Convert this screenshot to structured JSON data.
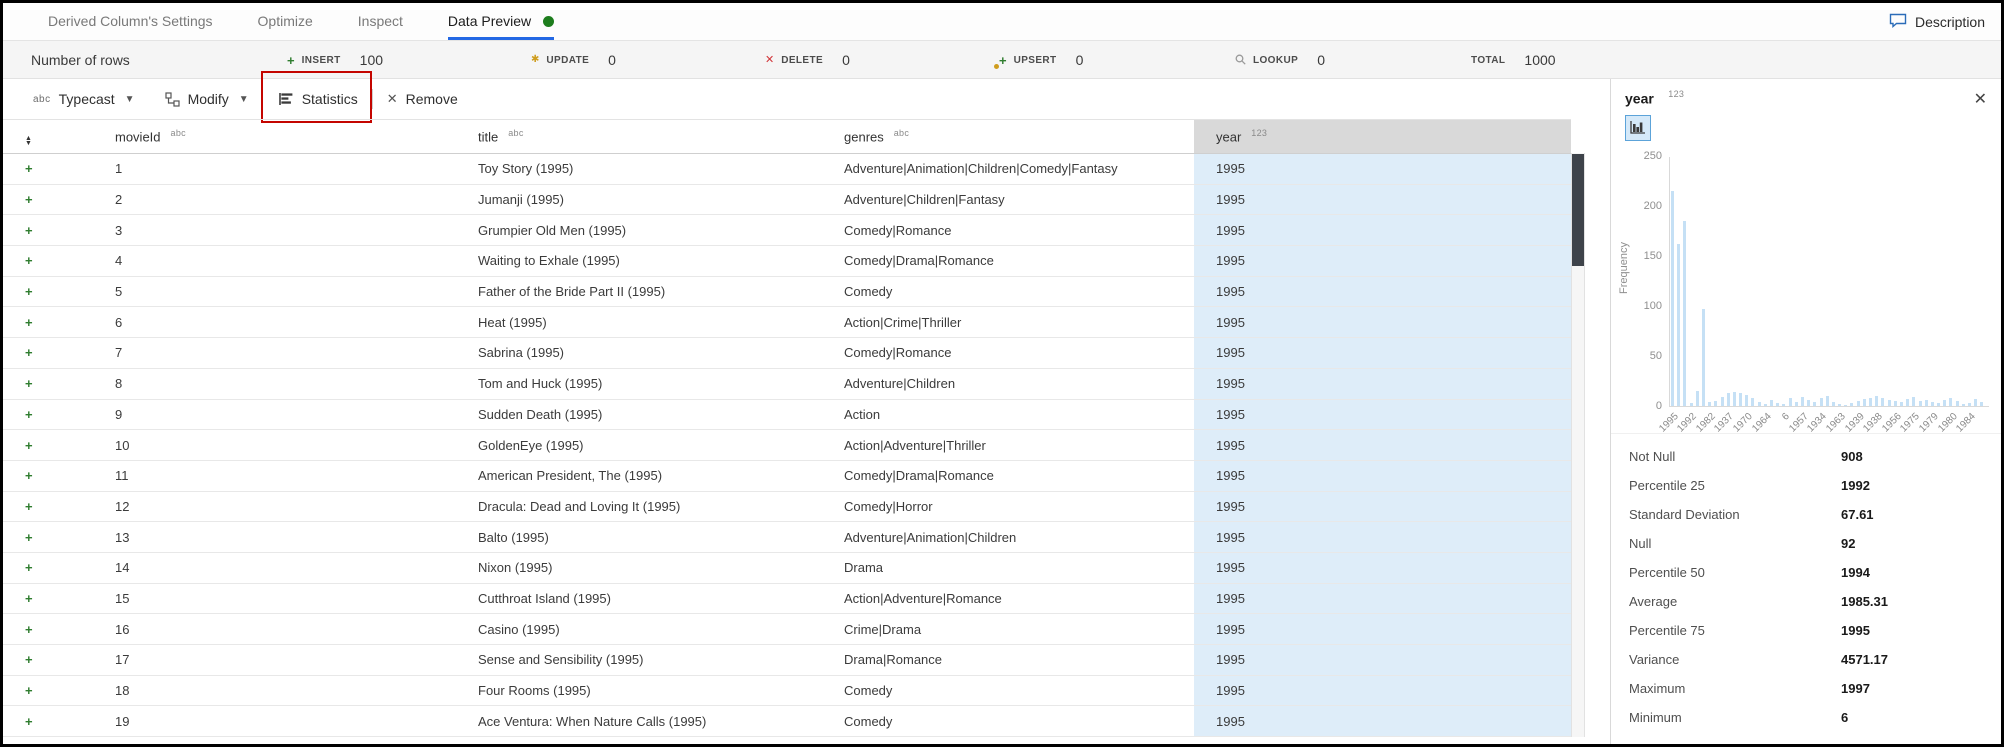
{
  "colors": {
    "accent_blue": "#2368e4",
    "active_dot_green": "#1d7d1d",
    "insert_green": "#2f7d2f",
    "update_amber": "#cf9d1e",
    "delete_red": "#d13438",
    "annotation_red": "#c40500",
    "year_cell_blue": "#deedf9",
    "year_header_gray": "#d9d9d9",
    "histogram_bar_blue": "#c5e0f5",
    "scrollbar_thumb": "#3e434a"
  },
  "tabs": {
    "items": [
      {
        "label": "Derived Column's Settings",
        "active": false
      },
      {
        "label": "Optimize",
        "active": false
      },
      {
        "label": "Inspect",
        "active": false
      },
      {
        "label": "Data Preview",
        "active": true
      }
    ],
    "description_label": "Description"
  },
  "metrics": {
    "title": "Number of rows",
    "items": [
      {
        "label": "INSERT",
        "value": "100",
        "icon": "plus",
        "x": 284
      },
      {
        "label": "UPDATE",
        "value": "0",
        "icon": "asterisk",
        "x": 528
      },
      {
        "label": "DELETE",
        "value": "0",
        "icon": "x",
        "x": 762
      },
      {
        "label": "UPSERT",
        "value": "0",
        "icon": "upsert",
        "x": 996
      },
      {
        "label": "LOOKUP",
        "value": "0",
        "icon": "search",
        "x": 1232
      }
    ],
    "total_label": "TOTAL",
    "total_value": "1000"
  },
  "toolbar": {
    "typecast_icon": "abc",
    "typecast_label": "Typecast",
    "modify_label": "Modify",
    "statistics_label": "Statistics",
    "remove_label": "Remove"
  },
  "grid": {
    "columns": [
      {
        "name": "movieId",
        "type": "abc"
      },
      {
        "name": "title",
        "type": "abc"
      },
      {
        "name": "genres",
        "type": "abc"
      },
      {
        "name": "year",
        "type": "123",
        "selected": true
      }
    ],
    "rows": [
      [
        "1",
        "Toy Story (1995)",
        "Adventure|Animation|Children|Comedy|Fantasy",
        "1995"
      ],
      [
        "2",
        "Jumanji (1995)",
        "Adventure|Children|Fantasy",
        "1995"
      ],
      [
        "3",
        "Grumpier Old Men (1995)",
        "Comedy|Romance",
        "1995"
      ],
      [
        "4",
        "Waiting to Exhale (1995)",
        "Comedy|Drama|Romance",
        "1995"
      ],
      [
        "5",
        "Father of the Bride Part II (1995)",
        "Comedy",
        "1995"
      ],
      [
        "6",
        "Heat (1995)",
        "Action|Crime|Thriller",
        "1995"
      ],
      [
        "7",
        "Sabrina (1995)",
        "Comedy|Romance",
        "1995"
      ],
      [
        "8",
        "Tom and Huck (1995)",
        "Adventure|Children",
        "1995"
      ],
      [
        "9",
        "Sudden Death (1995)",
        "Action",
        "1995"
      ],
      [
        "10",
        "GoldenEye (1995)",
        "Action|Adventure|Thriller",
        "1995"
      ],
      [
        "11",
        "American President, The (1995)",
        "Comedy|Drama|Romance",
        "1995"
      ],
      [
        "12",
        "Dracula: Dead and Loving It (1995)",
        "Comedy|Horror",
        "1995"
      ],
      [
        "13",
        "Balto (1995)",
        "Adventure|Animation|Children",
        "1995"
      ],
      [
        "14",
        "Nixon (1995)",
        "Drama",
        "1995"
      ],
      [
        "15",
        "Cutthroat Island (1995)",
        "Action|Adventure|Romance",
        "1995"
      ],
      [
        "16",
        "Casino (1995)",
        "Crime|Drama",
        "1995"
      ],
      [
        "17",
        "Sense and Sensibility (1995)",
        "Drama|Romance",
        "1995"
      ],
      [
        "18",
        "Four Rooms (1995)",
        "Comedy",
        "1995"
      ],
      [
        "19",
        "Ace Ventura: When Nature Calls (1995)",
        "Comedy",
        "1995"
      ]
    ]
  },
  "panel": {
    "title": "year",
    "type_badge": "123",
    "close_icon": "✕",
    "stats": [
      {
        "label": "Not Null",
        "value": "908"
      },
      {
        "label": "Percentile 25",
        "value": "1992"
      },
      {
        "label": "Standard Deviation",
        "value": "67.61"
      },
      {
        "label": "Null",
        "value": "92"
      },
      {
        "label": "Percentile 50",
        "value": "1994"
      },
      {
        "label": "Average",
        "value": "1985.31"
      },
      {
        "label": "Percentile 75",
        "value": "1995"
      },
      {
        "label": "Variance",
        "value": "4571.17"
      },
      {
        "label": "Maximum",
        "value": "1997"
      },
      {
        "label": "Minimum",
        "value": "6"
      }
    ]
  },
  "chart_data": {
    "type": "bar",
    "title": "year histogram",
    "ylabel": "Frequency",
    "xlabel": "",
    "ylim": [
      0,
      250
    ],
    "yticks": [
      0,
      50,
      100,
      150,
      200,
      250
    ],
    "grid": false,
    "x_tick_labels": [
      "1995",
      "1992",
      "1982",
      "1937",
      "1970",
      "1964",
      "6",
      "1957",
      "1934",
      "1963",
      "1939",
      "1938",
      "1956",
      "1975",
      "1979",
      "1980",
      "1984"
    ],
    "label_every_n_bars": 3,
    "values": [
      215,
      162,
      185,
      3,
      15,
      97,
      4,
      5,
      9,
      13,
      14,
      13,
      11,
      8,
      4,
      2,
      6,
      3,
      2,
      8,
      4,
      9,
      6,
      4,
      8,
      10,
      4,
      2,
      1,
      3,
      5,
      7,
      8,
      10,
      8,
      6,
      5,
      4,
      7,
      9,
      5,
      6,
      4,
      3,
      6,
      8,
      5,
      2,
      3,
      7,
      4
    ]
  }
}
